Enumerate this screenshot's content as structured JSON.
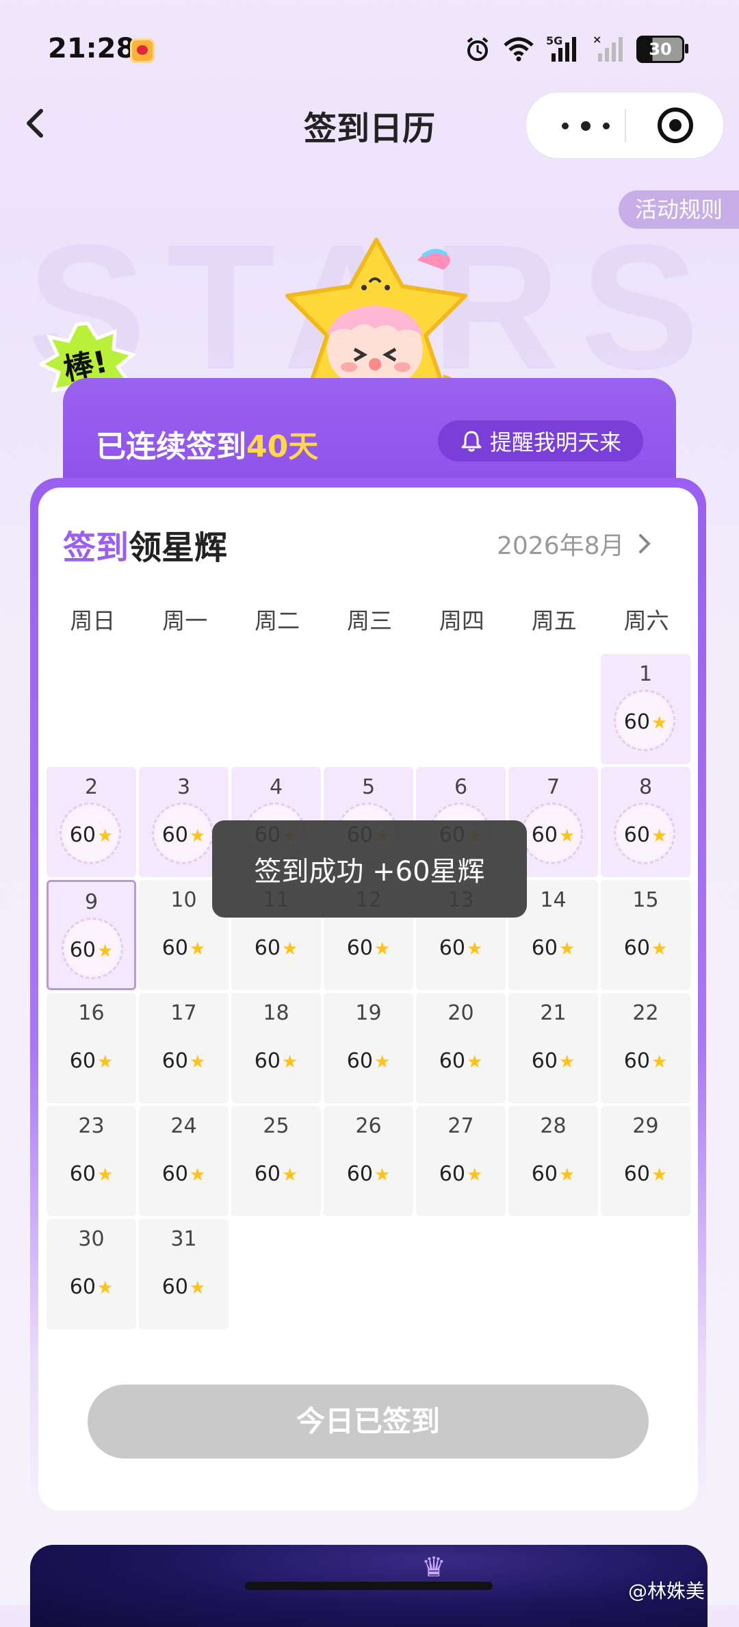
{
  "status_bar": {
    "time": "21:28",
    "network": "5G",
    "battery": "30"
  },
  "nav": {
    "back_icon": "chevron-left-icon",
    "title": "签到日历"
  },
  "rules_label": "活动规则",
  "watermark_text": "STARS",
  "praise_badge": "棒!",
  "streak": {
    "prefix": "已连续签到",
    "days": "40天"
  },
  "remind_label": "提醒我明天来",
  "card": {
    "title_highlight": "签到",
    "title_rest": "领星辉",
    "month": "2026年8月"
  },
  "weekdays": [
    "周日",
    "周一",
    "周二",
    "周三",
    "周四",
    "周五",
    "周六"
  ],
  "days": [
    {
      "d": "1",
      "v": "60",
      "state": "signed"
    },
    {
      "d": "2",
      "v": "60",
      "state": "signed"
    },
    {
      "d": "3",
      "v": "60",
      "state": "signed"
    },
    {
      "d": "4",
      "v": "60",
      "state": "signed"
    },
    {
      "d": "5",
      "v": "60",
      "state": "signed"
    },
    {
      "d": "6",
      "v": "60",
      "state": "signed"
    },
    {
      "d": "7",
      "v": "60",
      "state": "signed"
    },
    {
      "d": "8",
      "v": "60",
      "state": "signed"
    },
    {
      "d": "9",
      "v": "60",
      "state": "today"
    },
    {
      "d": "10",
      "v": "60",
      "state": "future"
    },
    {
      "d": "11",
      "v": "60",
      "state": "future"
    },
    {
      "d": "12",
      "v": "60",
      "state": "future"
    },
    {
      "d": "13",
      "v": "60",
      "state": "future"
    },
    {
      "d": "14",
      "v": "60",
      "state": "future"
    },
    {
      "d": "15",
      "v": "60",
      "state": "future"
    },
    {
      "d": "16",
      "v": "60",
      "state": "future"
    },
    {
      "d": "17",
      "v": "60",
      "state": "future"
    },
    {
      "d": "18",
      "v": "60",
      "state": "future"
    },
    {
      "d": "19",
      "v": "60",
      "state": "future"
    },
    {
      "d": "20",
      "v": "60",
      "state": "future"
    },
    {
      "d": "21",
      "v": "60",
      "state": "future"
    },
    {
      "d": "22",
      "v": "60",
      "state": "future"
    },
    {
      "d": "23",
      "v": "60",
      "state": "future"
    },
    {
      "d": "24",
      "v": "60",
      "state": "future"
    },
    {
      "d": "25",
      "v": "60",
      "state": "future"
    },
    {
      "d": "26",
      "v": "60",
      "state": "future"
    },
    {
      "d": "27",
      "v": "60",
      "state": "future"
    },
    {
      "d": "28",
      "v": "60",
      "state": "future"
    },
    {
      "d": "29",
      "v": "60",
      "state": "future"
    },
    {
      "d": "30",
      "v": "60",
      "state": "future"
    },
    {
      "d": "31",
      "v": "60",
      "state": "future"
    }
  ],
  "first_weekday_index": 6,
  "toast": "签到成功 +60星辉",
  "signed_button": "今日已签到",
  "image_watermark": "@林姝美",
  "colors": {
    "accent": "#9a5ff0",
    "star": "#ffc21a",
    "streak_days": "#ffd84a"
  }
}
